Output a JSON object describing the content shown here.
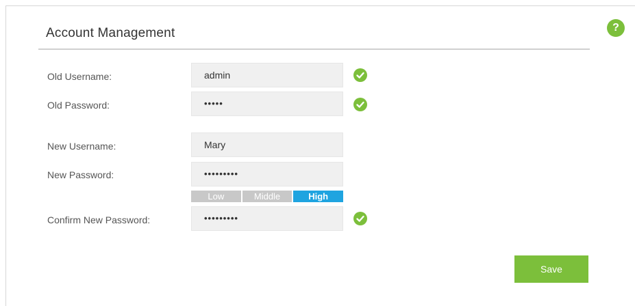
{
  "section": {
    "title": "Account Management"
  },
  "form": {
    "old_username_label": "Old Username:",
    "old_username_value": "admin",
    "old_password_label": "Old Password:",
    "old_password_value": "•••••",
    "new_username_label": "New Username:",
    "new_username_value": "Mary",
    "new_password_label": "New Password:",
    "new_password_value": "•••••••••",
    "confirm_password_label": "Confirm New Password:",
    "confirm_password_value": "•••••••••"
  },
  "strength_meter": {
    "low": "Low",
    "middle": "Middle",
    "high": "High",
    "current": "High"
  },
  "actions": {
    "save_label": "Save",
    "help_label": "?"
  },
  "colors": {
    "accent_green": "#7cbf3b",
    "strength_high": "#1fa4e0",
    "strength_inactive": "#c8c8c8"
  }
}
